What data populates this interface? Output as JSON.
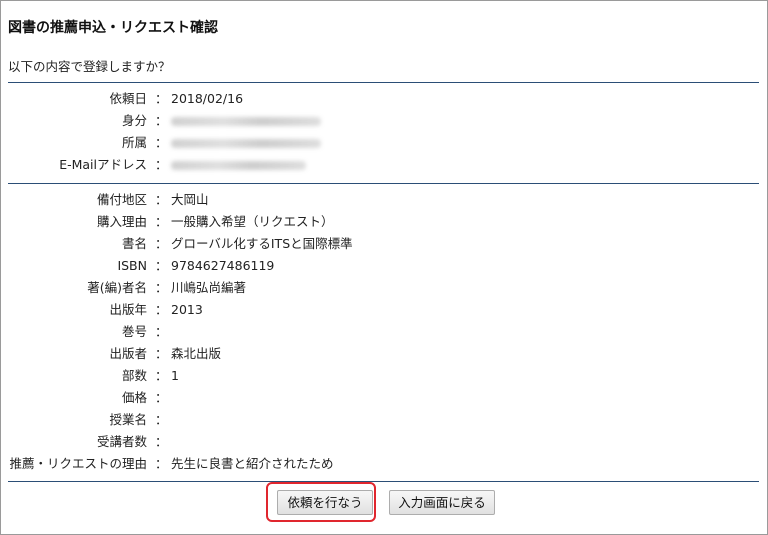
{
  "page": {
    "title": "図書の推薦申込・リクエスト確認",
    "intro": "以下の内容で登録しますか？",
    "separator": "："
  },
  "requester": {
    "fields": [
      {
        "label": "依頼日",
        "value": "2018/02/16",
        "redacted": false
      },
      {
        "label": "身分",
        "value": "",
        "redacted": true
      },
      {
        "label": "所属",
        "value": "",
        "redacted": true
      },
      {
        "label": "E-Mailアドレス",
        "value": "",
        "redacted": true
      }
    ]
  },
  "book": {
    "fields": [
      {
        "label": "備付地区",
        "value": "大岡山"
      },
      {
        "label": "購入理由",
        "value": "一般購入希望（リクエスト）"
      },
      {
        "label": "書名",
        "value": "グローバル化するITSと国際標準"
      },
      {
        "label": "ISBN",
        "value": "9784627486119"
      },
      {
        "label": "著(編)者名",
        "value": "川嶋弘尚編著"
      },
      {
        "label": "出版年",
        "value": "2013"
      },
      {
        "label": "巻号",
        "value": ""
      },
      {
        "label": "出版者",
        "value": "森北出版"
      },
      {
        "label": "部数",
        "value": "1"
      },
      {
        "label": "価格",
        "value": ""
      },
      {
        "label": "授業名",
        "value": ""
      },
      {
        "label": "受講者数",
        "value": ""
      },
      {
        "label": "推薦・リクエストの理由",
        "value": "先生に良書と紹介されたため"
      }
    ]
  },
  "actions": {
    "submit_label": "依頼を行なう",
    "back_label": "入力画面に戻る"
  },
  "colors": {
    "divider": "#2b4e76",
    "highlight": "#e0262e"
  }
}
